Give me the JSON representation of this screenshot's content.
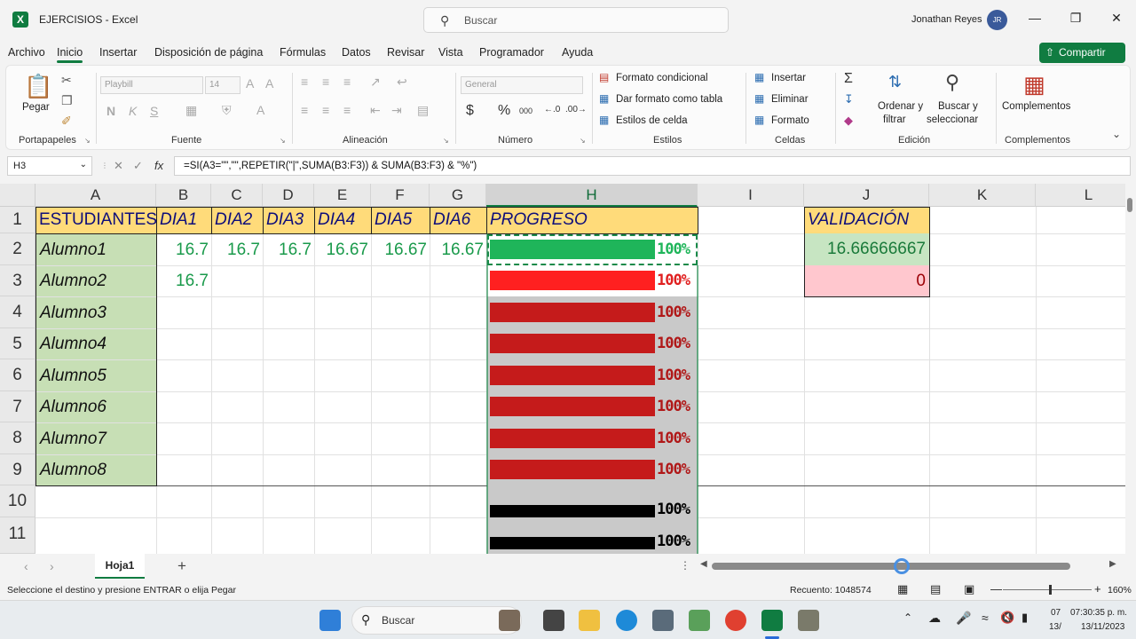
{
  "window": {
    "doc_title": "EJERCISIOS  -  Excel",
    "search_placeholder": "Buscar",
    "user_name": "Jonathan Reyes",
    "user_initials": "JR"
  },
  "tabs": [
    "Archivo",
    "Inicio",
    "Insertar",
    "Disposición de página",
    "Fórmulas",
    "Datos",
    "Revisar",
    "Vista",
    "Programador",
    "Ayuda"
  ],
  "active_tab": "Inicio",
  "share_label": "Compartir",
  "ribbon": {
    "groups": {
      "clipboard": "Portapapeles",
      "font": "Fuente",
      "alignment": "Alineación",
      "number": "Número",
      "styles": "Estilos",
      "cells": "Celdas",
      "editing": "Edición",
      "addins": "Complementos"
    },
    "paste_label": "Pegar",
    "font_name": "Playbill",
    "font_size": "14",
    "number_format": "General",
    "conditional_format": "Formato condicional",
    "format_as_table": "Dar formato como tabla",
    "cell_styles": "Estilos de celda",
    "insert": "Insertar",
    "delete": "Eliminar",
    "format": "Formato",
    "sort_filter_1": "Ordenar y",
    "sort_filter_2": "filtrar",
    "find_select_1": "Buscar y",
    "find_select_2": "seleccionar",
    "addins_btn": "Complementos"
  },
  "formula_bar": {
    "name_box": "H3",
    "formula": "=SI(A3=\"\",\"\",REPETIR(\"|\",SUMA(B3:F3)) & SUMA(B3:F3) & \"%\")"
  },
  "columns": [
    "A",
    "B",
    "C",
    "D",
    "E",
    "F",
    "G",
    "H",
    "I",
    "J",
    "K",
    "L"
  ],
  "rows": [
    "1",
    "2",
    "3",
    "4",
    "5",
    "6",
    "7",
    "8",
    "9",
    "10",
    "11"
  ],
  "sheet": {
    "header_row": {
      "A": "ESTUDIANTES",
      "B": "DIA1",
      "C": "DIA2",
      "D": "DIA3",
      "E": "DIA4",
      "F": "DIA5",
      "G": "DIA6",
      "H": "PROGRESO",
      "J": "VALIDACIÓN"
    },
    "students": [
      "Alumno1",
      "Alumno2",
      "Alumno3",
      "Alumno4",
      "Alumno5",
      "Alumno6",
      "Alumno7",
      "Alumno8"
    ],
    "row2_values": [
      "16.7",
      "16.7",
      "16.7",
      "16.67",
      "16.67",
      "16.67"
    ],
    "row3_values": [
      "16.7"
    ],
    "progress_label": "100%",
    "validation_values": [
      "16.66666667",
      "0"
    ]
  },
  "colors": {
    "header_fill": "#ffdb7a",
    "student_fill": "#c7dfb5",
    "bar_green": "#1fb55a",
    "bar_red_bright": "#ff2020",
    "bar_red": "#c51b1b",
    "bar_black": "#000000",
    "validation_pink": "#ffc7ce",
    "excel_green": "#107c41"
  },
  "sheet_tab": "Hoja1",
  "status": {
    "message": "Seleccione el destino y presione ENTRAR o elija Pegar",
    "count": "Recuento: 1048574",
    "zoom": "160%"
  },
  "taskbar": {
    "search": "Buscar",
    "time": "07:30:35 p. m.",
    "date": "13/11/2023",
    "left_clip_1": "07",
    "left_clip_2": "13/"
  }
}
